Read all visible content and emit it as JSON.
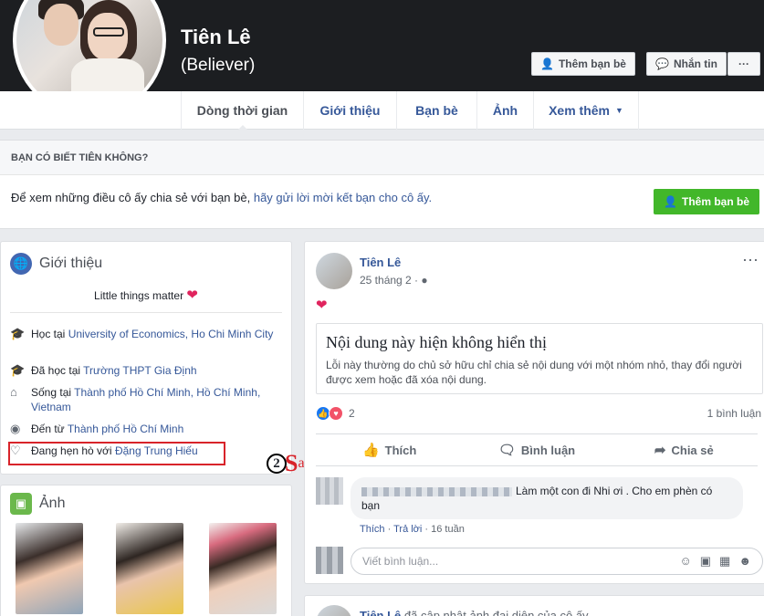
{
  "profile": {
    "name": "Tiên Lê",
    "alt_name": "(Believer)",
    "add_friend": "Thêm bạn bè",
    "message": "Nhắn tin",
    "more": "···"
  },
  "tabs": [
    {
      "label": "Dòng thời gian",
      "active": true
    },
    {
      "label": "Giới thiệu"
    },
    {
      "label": "Bạn bè"
    },
    {
      "label": "Ảnh"
    },
    {
      "label": "Xem thêm"
    }
  ],
  "know": {
    "heading": "BẠN CÓ BIẾT TIÊN KHÔNG?",
    "text": "Để xem những điều cô ấy chia sẻ với bạn bè,",
    "link": "hãy gửi lời mời kết bạn cho cô ấy.",
    "button": "Thêm bạn bè"
  },
  "intro": {
    "title": "Giới thiệu",
    "bio": "Little things matter",
    "items": [
      {
        "icon": "education-icon",
        "prefix": "Học tại",
        "link": "University of Economics, Ho Chi Minh City"
      },
      {
        "icon": "education-icon",
        "prefix": "Đã học tại",
        "link": "Trường THPT Gia Định"
      },
      {
        "icon": "home-icon",
        "prefix": "Sống tại",
        "link": "Thành phố Hồ Chí Minh, Hồ Chí Minh, Vietnam"
      },
      {
        "icon": "location-icon",
        "prefix": "Đến từ",
        "link": "Thành phố Hồ Chí Minh"
      },
      {
        "icon": "heart-outline-icon",
        "prefix": "Đang hẹn hò với",
        "link": "Đặng Trung Hiếu"
      }
    ]
  },
  "photos": {
    "title": "Ảnh"
  },
  "post": {
    "author": "Tiên Lê",
    "date": "25 tháng 2 ·",
    "unavailable_title": "Nội dung này hiện không hiển thị",
    "unavailable_text": "Lỗi này thường do chủ sở hữu chỉ chia sẻ nội dung với một nhóm nhỏ, thay đổi người được xem hoặc đã xóa nội dung.",
    "reaction_count": "2",
    "comment_count": "1 bình luận",
    "like": "Thích",
    "comment": "Bình luận",
    "share": "Chia sẻ"
  },
  "comment": {
    "text": "Làm một con đi Nhi ơi . Cho em phèn có bạn",
    "like": "Thích",
    "reply": "Trả lời",
    "time": "16 tuần"
  },
  "write_comment": {
    "placeholder": "Viết bình luận..."
  },
  "post2": {
    "author": "Tiên Lê",
    "action": "đã cập nhật ảnh đại diện của cô ấy."
  },
  "watermark": {
    "digit": "2",
    "s": "S",
    "ao": "ao"
  },
  "colors": {
    "link": "#365899",
    "green": "#42b72a",
    "highlight": "#d8232a"
  }
}
